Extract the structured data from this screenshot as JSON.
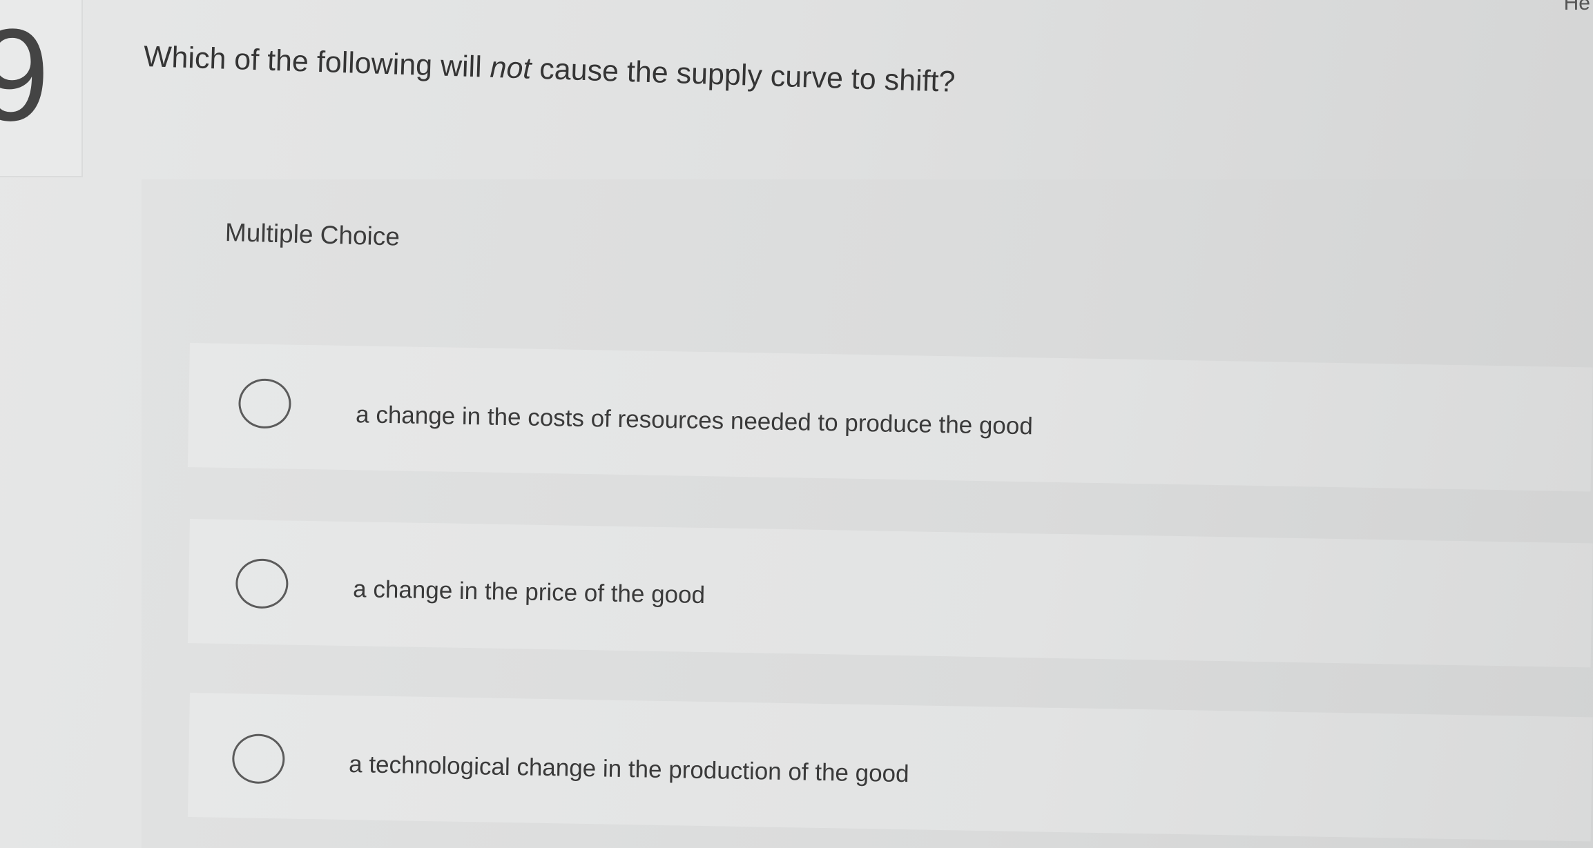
{
  "question": {
    "number": "9",
    "text_before": "Which of the following will ",
    "text_emphasis": "not",
    "text_after": " cause the supply curve to shift?"
  },
  "answer_type_label": "Multiple Choice",
  "choices": [
    {
      "label": "a change in the costs of resources needed to produce the good",
      "selected": false
    },
    {
      "label": "a change in the price of the good",
      "selected": false
    },
    {
      "label": "a technological change in the production of the good",
      "selected": false
    }
  ],
  "right_edge_label": "He"
}
